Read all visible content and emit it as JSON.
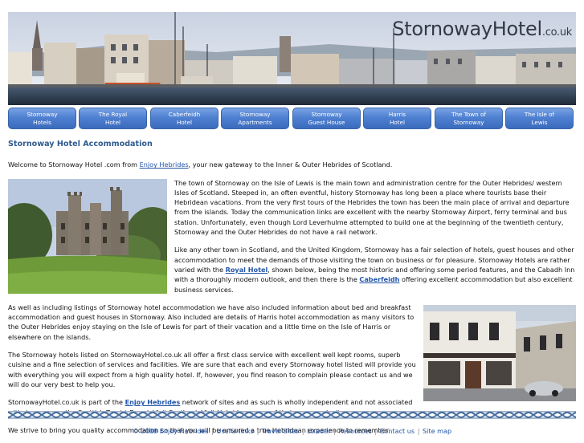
{
  "header": {
    "logo_main": "StornowayHotel",
    "logo_tld": ".co.uk"
  },
  "nav": {
    "tabs": [
      {
        "line1": "Stornoway",
        "line2": "Hotels"
      },
      {
        "line1": "The Royal",
        "line2": "Hotel"
      },
      {
        "line1": "Caberfeidh",
        "line2": "Hotel"
      },
      {
        "line1": "Stornoway",
        "line2": "Apartments"
      },
      {
        "line1": "Stornoway",
        "line2": "Guest House"
      },
      {
        "line1": "Harris",
        "line2": "Hotel"
      },
      {
        "line1": "The Town of",
        "line2": "Stornoway"
      },
      {
        "line1": "The Isle of",
        "line2": "Lewis"
      }
    ]
  },
  "main": {
    "title": "Stornoway Hotel Accommodation",
    "intro_before": "Welcome to Stornoway Hotel .com from ",
    "intro_link": "Enjoy Hebrides",
    "intro_after": ", your new gateway to the Inner & Outer Hebrides of Scotland.",
    "p1": "The town of Stornoway on the Isle of Lewis is the main town and administration centre for the Outer Hebrides/ western Isles of Scotland. Steeped in, an often eventful, history Stornoway has long been a place where tourists base their Hebridean vacations. From the very first tours of the Hebrides the town has been the main place of arrival and departure from the islands. Today the communication links are excellent with the nearby Stornoway Airport, ferry terminal and bus station. Unfortunately, even though Lord Leverhulme attempted to build one at the beginning of the twentieth century, Stornoway and the Outer Hebrides do not have a rail network.",
    "p2_before": "Like any other town in Scotland, and the United Kingdom, Stornoway has a fair selection of hotels, guest houses and other accommodation to meet the demands of those visiting the town on business or for pleasure. Stornoway Hotels are rather varied with the ",
    "p2_link1": "Royal Hotel",
    "p2_mid": ", shown below, being the most historic and offering some period features, and the Cabadh Inn with a thoroughly modern outlook, and then there is the ",
    "p2_link2": "Caberfeidh",
    "p2_after": " offering excellent accommodation but also excellent business services.",
    "p3": "As well as including listings of Stornoway hotel accommodation we have also included information about bed and breakfast accommodation and guest houses in Stornoway. Also included are details of Harris hotel accommodation as many visitors to the Outer Hebrides enjoy staying on the Isle of Lewis for part of their vacation and a little time on the Isle of Harris or elsewhere on the islands.",
    "p4": "The Stornoway hotels listed on StornowayHotel.co.uk all offer a first class service with excellent well kept rooms, superb cuisine and a fine selection of services and facilities. We are sure that each and every Stornoway hotel listed will provide you with everything you will expect from a high quality hotel. If, however, you find reason to complain please contact us and we will do our very best to help you.",
    "p5_before": "StornowayHotel.co.uk is part of the ",
    "p5_link": "Enjoy Hebrides",
    "p5_after": " network of sites and as such is wholly independent and not associated with, in any way, the Scottish Tourist Board, Visit Scotland, Visit Hebrides or any of their many web sites.",
    "p6": "We strive to bring you quality accommodation so that you will be ensured a true Hebridean experience to remember."
  },
  "footer": {
    "copyright": "© 2008 Enjoy Hebrides",
    "links": [
      "Useful links",
      "Travel Sites",
      "Ltrader",
      "Resources",
      "Contact us",
      "Site map"
    ],
    "separator": "|"
  }
}
